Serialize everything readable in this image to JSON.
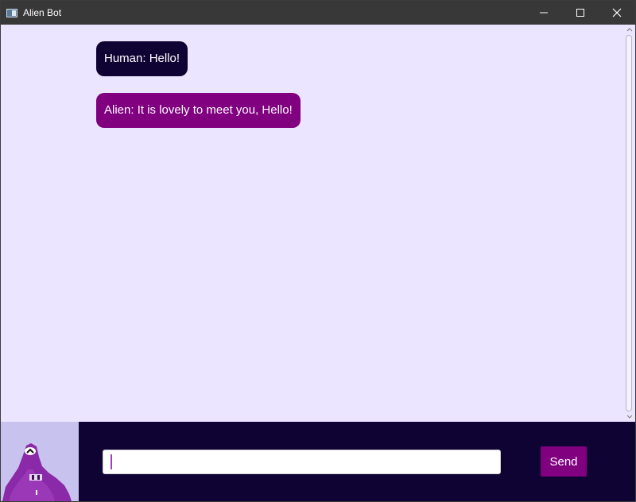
{
  "window": {
    "title": "Alien Bot",
    "controls": [
      "minimize-icon",
      "maximize-icon",
      "close-icon"
    ]
  },
  "chat": {
    "messages": [
      {
        "sender": "Human",
        "text": "Human: Hello!",
        "color": "#0e0333"
      },
      {
        "sender": "Alien",
        "text": "Alien: It is lovely to meet you, Hello!",
        "color": "#800080"
      }
    ]
  },
  "input": {
    "value": "",
    "placeholder": ""
  },
  "send_button": {
    "label": "Send"
  },
  "colors": {
    "chat_background": "#ebe5ff",
    "bottom_bar": "#0e0333",
    "accent": "#800080",
    "titlebar": "#383838"
  },
  "avatar": {
    "icon": "alien-avatar-icon"
  }
}
